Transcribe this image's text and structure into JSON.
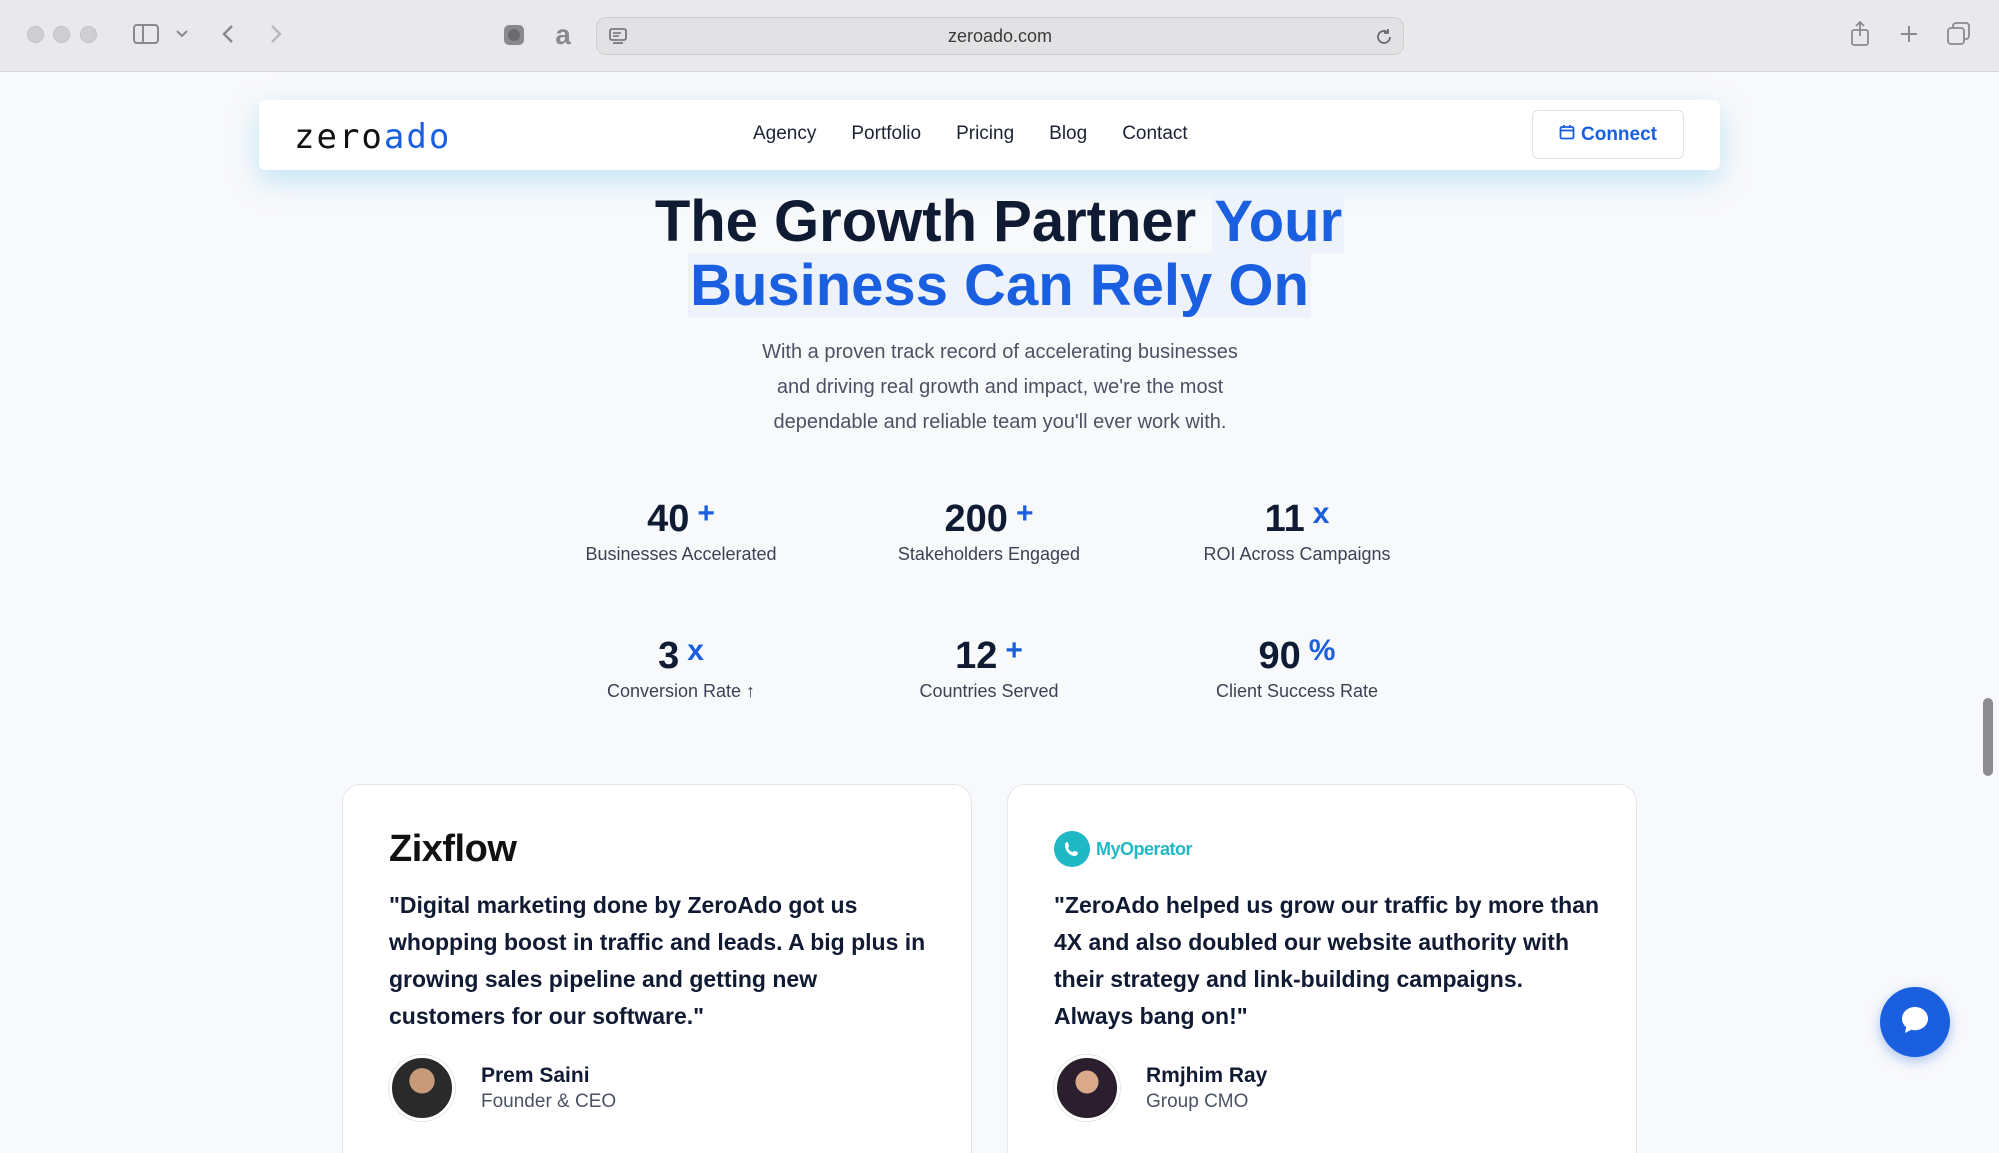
{
  "browser": {
    "url": "zeroado.com"
  },
  "nav": {
    "logo_part1": "zero",
    "logo_part2": "ado",
    "links": [
      "Agency",
      "Portfolio",
      "Pricing",
      "Blog",
      "Contact"
    ],
    "connect_label": "Connect"
  },
  "hero": {
    "title_line1_dark": "The Growth Partner",
    "title_line1_blue": "Your",
    "title_line2_blue": "Business Can Rely On",
    "subtitle_lines": [
      "With a proven track record of accelerating businesses",
      "and driving real growth and impact, we're the most",
      "dependable and reliable team you'll ever work with."
    ]
  },
  "stats": [
    {
      "value": "40",
      "suffix": "+",
      "label": "Businesses Accelerated"
    },
    {
      "value": "200",
      "suffix": "+",
      "label": "Stakeholders Engaged"
    },
    {
      "value": "11",
      "suffix": "x",
      "label": "ROI Across Campaigns"
    },
    {
      "value": "3",
      "suffix": "x",
      "label": "Conversion Rate ↑"
    },
    {
      "value": "12",
      "suffix": "+",
      "label": "Countries Served"
    },
    {
      "value": "90",
      "suffix": "%",
      "label": "Client Success Rate"
    }
  ],
  "testimonials": [
    {
      "brand": "Zixflow",
      "quote": "\"Digital marketing done by ZeroAdo got us whopping boost in traffic and leads. A big plus in growing sales pipeline and getting new customers for our software.\"",
      "name": "Prem Saini",
      "role": "Founder & CEO"
    },
    {
      "brand": "MyOperator",
      "quote": "\"ZeroAdo helped us grow our traffic by more than 4X and also doubled our website authority with their strategy and link-building campaigns. Always bang on!\"",
      "name": "Rmjhim Ray",
      "role": "Group CMO"
    }
  ],
  "colors": {
    "accent": "#1a5fe0",
    "heading": "#0f1a33",
    "myoperator": "#1fb8c4"
  }
}
